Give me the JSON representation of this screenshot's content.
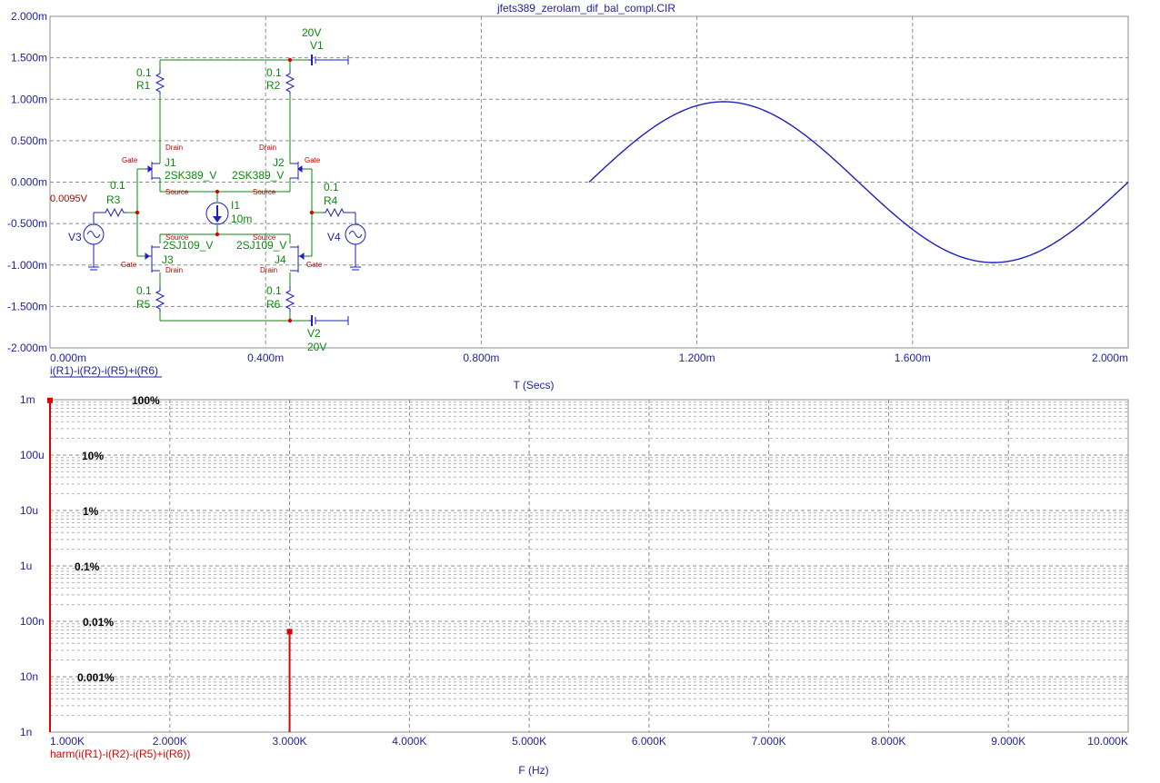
{
  "window_title": "jfets389_zerolam_dif_bal_compl.CIR",
  "colors": {
    "grid": "#8c8c8c",
    "axis_text": "#1f1f9f",
    "trace_time": "#1f1fbf",
    "trace_harm": "#e00000",
    "schematic_wire": "#0a8a0a",
    "schematic_part": "#1f1fbf",
    "schematic_pin": "#c00000"
  },
  "chart_data": [
    {
      "type": "line",
      "title": "jfets389_zerolam_dif_bal_compl.CIR",
      "xlabel": "T (Secs)",
      "ylabel": "",
      "xlim": [
        0,
        0.002
      ],
      "ylim": [
        -0.002,
        0.002
      ],
      "x_ticks": [
        "0.000m",
        "0.400m",
        "0.800m",
        "1.200m",
        "1.600m",
        "2.000m"
      ],
      "y_ticks": [
        "2.000m",
        "1.500m",
        "1.000m",
        "0.500m",
        "0.000m",
        "-0.500m",
        "-1.000m",
        "-1.500m",
        "-2.000m"
      ],
      "grid": true,
      "series": [
        {
          "name": "i(R1)-i(R2)-i(R5)+i(R6)",
          "x_start": 0.001,
          "x_end": 0.002,
          "amplitude": 0.00097,
          "period": 0.001,
          "offset": 0
        }
      ]
    },
    {
      "type": "bar",
      "title": "",
      "xlabel": "F (Hz)",
      "ylabel": "",
      "y_scale": "log",
      "xlim": [
        1000,
        10000
      ],
      "ylim": [
        1e-09,
        0.001
      ],
      "x_ticks": [
        "1.000K",
        "2.000K",
        "3.000K",
        "4.000K",
        "5.000K",
        "6.000K",
        "7.000K",
        "8.000K",
        "9.000K",
        "10.000K"
      ],
      "y_ticks": [
        "1m",
        "100u",
        "10u",
        "1u",
        "100n",
        "10n",
        "1n"
      ],
      "grid": true,
      "series": [
        {
          "name": "harm(i(R1)-i(R2)-i(R5)+i(R6))",
          "points": [
            {
              "x": 1000,
              "y": 0.00097
            },
            {
              "x": 3000,
              "y": 6.5e-08
            }
          ]
        }
      ],
      "percent_labels": [
        {
          "text": "100%",
          "y": 0.001
        },
        {
          "text": "10%",
          "y": 0.0001
        },
        {
          "text": "1%",
          "y": 1e-05
        },
        {
          "text": "0.1%",
          "y": 1e-06
        },
        {
          "text": "0.01%",
          "y": 1e-07
        },
        {
          "text": "0.001%",
          "y": 1e-08
        }
      ]
    }
  ],
  "schematic": {
    "resistors": [
      {
        "name": "R1",
        "value": "0.1"
      },
      {
        "name": "R2",
        "value": "0.1"
      },
      {
        "name": "R3",
        "value": "0.1"
      },
      {
        "name": "R4",
        "value": "0.1"
      },
      {
        "name": "R5",
        "value": "0.1"
      },
      {
        "name": "R6",
        "value": "0.1"
      }
    ],
    "jfets": [
      {
        "name": "J1",
        "model": "2SK389_V"
      },
      {
        "name": "J2",
        "model": "2SK389_V"
      },
      {
        "name": "J3",
        "model": "2SJ109_V"
      },
      {
        "name": "J4",
        "model": "2SJ109_V"
      }
    ],
    "sources": [
      {
        "name": "V1",
        "value": "20V"
      },
      {
        "name": "V2",
        "value": "20V"
      },
      {
        "name": "V3"
      },
      {
        "name": "V4"
      },
      {
        "name": "I1",
        "value": "10m"
      }
    ],
    "pins": {
      "gate": "Gate",
      "drain": "Drain",
      "source": "Source"
    },
    "node_voltage": "0.0095V"
  }
}
